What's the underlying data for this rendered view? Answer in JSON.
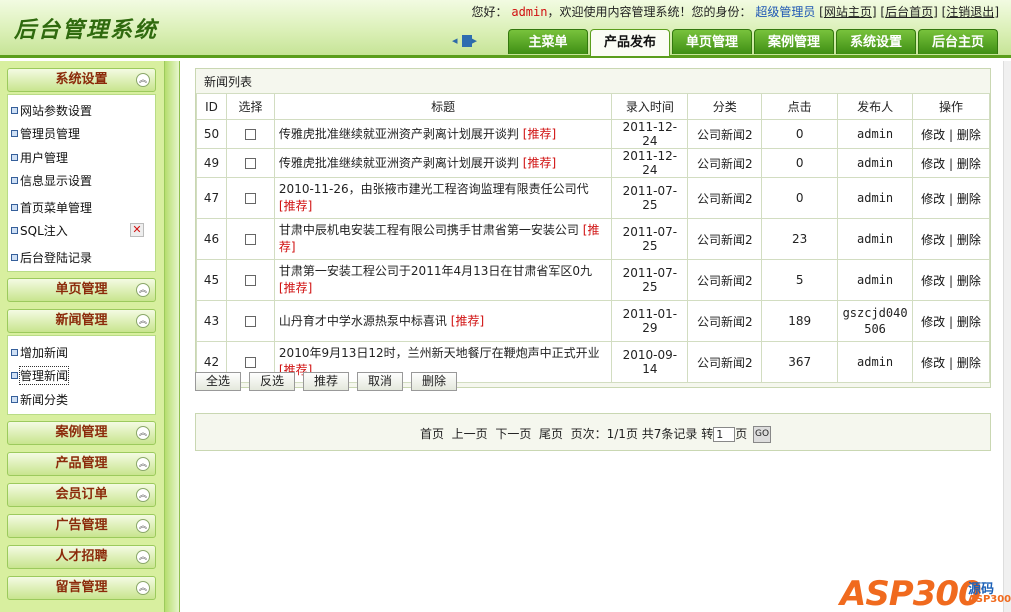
{
  "header": {
    "logo": "后台管理系统",
    "greeting": "您好：",
    "username": "admin",
    "welcome": "，欢迎使用内容管理系统！您的身份：",
    "role": "超级管理员",
    "links": [
      "网站主页",
      "后台首页",
      "注销退出"
    ]
  },
  "nav": {
    "tabs": [
      "主菜单",
      "产品发布",
      "单页管理",
      "案例管理",
      "系统设置",
      "后台主页"
    ],
    "active": "产品发布"
  },
  "sidebar": {
    "system": {
      "title": "系统设置",
      "items": [
        "网站参数设置",
        "管理员管理",
        "用户管理",
        "信息显示设置",
        "首页菜单管理",
        "SQL注入",
        "后台登陆记录"
      ]
    },
    "single_page": {
      "title": "单页管理"
    },
    "news": {
      "title": "新闻管理",
      "items": [
        "增加新闻",
        "管理新闻",
        "新闻分类"
      ]
    },
    "sections": [
      "案例管理",
      "产品管理",
      "会员订单",
      "广告管理",
      "人才招聘",
      "留言管理"
    ],
    "toggle_glyph": "︽",
    "red_x": "✕"
  },
  "main": {
    "panel_title": "新闻列表",
    "columns": [
      "ID",
      "选择",
      "标题",
      "录入时间",
      "分类",
      "点击",
      "发布人",
      "操作"
    ],
    "rows": [
      {
        "id": "50",
        "title": "传雅虎批准继续就亚洲资产剥离计划展开谈判",
        "tag": "[推荐]",
        "date": "2011-12-24",
        "category": "公司新闻2",
        "clicks": "0",
        "publisher": "admin",
        "edit": "修改",
        "sep": "|",
        "delete": "删除"
      },
      {
        "id": "49",
        "title": "传雅虎批准继续就亚洲资产剥离计划展开谈判",
        "tag": "[推荐]",
        "date": "2011-12-24",
        "category": "公司新闻2",
        "clicks": "0",
        "publisher": "admin",
        "edit": "修改",
        "sep": "|",
        "delete": "删除"
      },
      {
        "id": "47",
        "title": "2010-11-26，由张掖市建光工程咨询监理有限责任公司代",
        "tag": "[推荐]",
        "date": "2011-07-25",
        "category": "公司新闻2",
        "clicks": "0",
        "publisher": "admin",
        "edit": "修改",
        "sep": "|",
        "delete": "删除"
      },
      {
        "id": "46",
        "title": "甘肃中辰机电安装工程有限公司携手甘肃省第一安装公司",
        "tag": "[推荐]",
        "date": "2011-07-25",
        "category": "公司新闻2",
        "clicks": "23",
        "publisher": "admin",
        "edit": "修改",
        "sep": "|",
        "delete": "删除"
      },
      {
        "id": "45",
        "title": "甘肃第一安装工程公司于2011年4月13日在甘肃省军区0九",
        "tag": "[推荐]",
        "date": "2011-07-25",
        "category": "公司新闻2",
        "clicks": "5",
        "publisher": "admin",
        "edit": "修改",
        "sep": "|",
        "delete": "删除"
      },
      {
        "id": "43",
        "title": "山丹育才中学水源热泵中标喜讯",
        "tag": "[推荐]",
        "date": "2011-01-29",
        "category": "公司新闻2",
        "clicks": "189",
        "publisher": "gszcjd040506",
        "edit": "修改",
        "sep": "|",
        "delete": "删除"
      },
      {
        "id": "42",
        "title": "2010年9月13日12时，兰州新天地餐厅在鞭炮声中正式开业",
        "tag": "[推荐]",
        "date": "2010-09-14",
        "category": "公司新闻2",
        "clicks": "367",
        "publisher": "admin",
        "edit": "修改",
        "sep": "|",
        "delete": "删除"
      }
    ],
    "buttons": [
      "全选",
      "反选",
      "推荐",
      "取消",
      "删除"
    ],
    "pager": {
      "first": "首页",
      "prev": "上一页",
      "next": "下一页",
      "last": "尾页",
      "info": "页次：1/1页 共7条记录 转",
      "page_input": "1",
      "page_suffix": "页",
      "go": "GO"
    }
  },
  "watermark": {
    "logo": "ASP300",
    "cn": "源码",
    "domain": "ASP300.COM"
  }
}
